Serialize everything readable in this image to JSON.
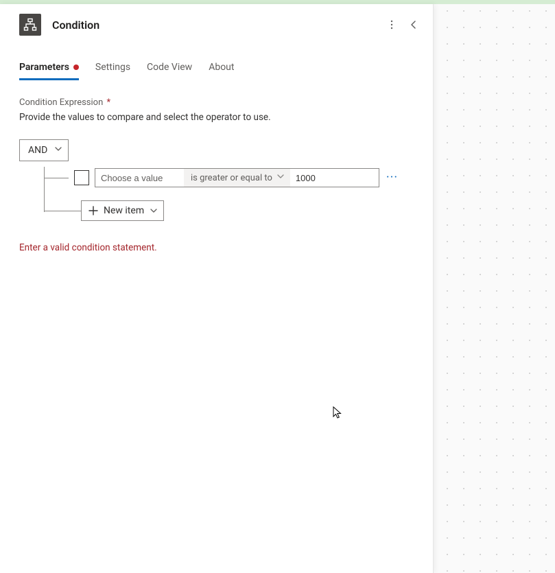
{
  "header": {
    "title": "Condition"
  },
  "tabs": {
    "parameters": "Parameters",
    "settings": "Settings",
    "codeview": "Code View",
    "about": "About"
  },
  "field": {
    "label": "Condition Expression",
    "required_marker": "*",
    "description": "Provide the values to compare and select the operator to use."
  },
  "expression": {
    "logic": "AND",
    "row": {
      "left_placeholder": "Choose a value",
      "left_value": "",
      "operator": "is greater or equal to",
      "right_value": "1000"
    },
    "new_item_label": "New item"
  },
  "error": "Enter a valid condition statement."
}
